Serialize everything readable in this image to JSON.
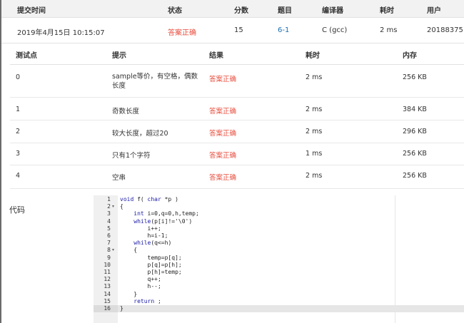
{
  "summary": {
    "headers": [
      "提交时间",
      "状态",
      "分数",
      "题目",
      "编译器",
      "耗时",
      "用户"
    ],
    "row": {
      "time": "2019年4月15日 10:15:07",
      "status": "答案正确",
      "score": "15",
      "problem": "6-1",
      "compiler": "C (gcc)",
      "elapsed": "2 ms",
      "user": "20188375"
    }
  },
  "tests": {
    "headers": [
      "测试点",
      "提示",
      "结果",
      "耗时",
      "内存"
    ],
    "rows": [
      {
        "id": "0",
        "hint": "sample等价，有空格，偶数长度",
        "result": "答案正确",
        "time": "2 ms",
        "memory": "256 KB"
      },
      {
        "id": "1",
        "hint": "奇数长度",
        "result": "答案正确",
        "time": "2 ms",
        "memory": "384 KB"
      },
      {
        "id": "2",
        "hint": "较大长度，超过20",
        "result": "答案正确",
        "time": "2 ms",
        "memory": "296 KB"
      },
      {
        "id": "3",
        "hint": "只有1个字符",
        "result": "答案正确",
        "time": "1 ms",
        "memory": "256 KB"
      },
      {
        "id": "4",
        "hint": "空串",
        "result": "答案正确",
        "time": "2 ms",
        "memory": "256 KB"
      }
    ]
  },
  "code_label": "代码",
  "code_lines": [
    "void f( char *p )",
    "{",
    "    int i=0,q=0,h,temp;",
    "    while(p[i]!='\\0')",
    "        i++;",
    "        h=i-1;",
    "    while(q<=h)",
    "    {",
    "        temp=p[q];",
    "        p[q]=p[h];",
    "        p[h]=temp;",
    "        q++;",
    "        h--;",
    "    }",
    "    return ;",
    "}"
  ],
  "colors": {
    "accepted": "#e74c3c",
    "link": "#1a6fb4",
    "keyword": "#1a1aa6"
  }
}
